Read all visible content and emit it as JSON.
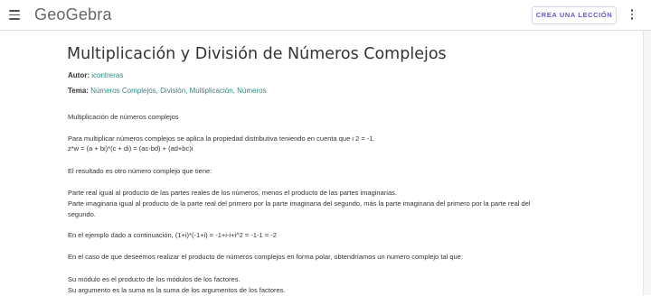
{
  "header": {
    "logo": "GeoGebra",
    "cta_label": "CREA UNA LECCIÓN"
  },
  "article": {
    "title": "Multiplicación y División de Números Complejos",
    "author_label": "Autor:",
    "author": "icontreras",
    "topic_label": "Tema:",
    "topics": [
      "Números Complejos",
      "División",
      "Multiplicación",
      "Números"
    ],
    "paragraphs": [
      "Multiplicación de números complejos",
      "Para multiplicar números complejos se aplica la propiedad distributiva teniendo en cuenta que i 2 = -1.",
      "z*w = (a + bi)*(c + di) = (ac-bd) + (ad+bc)i",
      "El resultado es otro número complejo que tiene:",
      "Parte real igual al producto de las partes reales de los números, menos el producto de las partes imaginarias.",
      "Parte imaginaria igual al producto de la parte real del primero por la parte imaginaria del segundo, más la parte imaginaria del primero por la parte real del",
      "segundo.",
      "En el ejemplo dado a continuación, (1+i)*(-1+i) = -1+i-i+i^2 = -1-1 = -2",
      "En el caso de que deseemos realizar el producto de números complejos en forma polar,  obtendríamos un numero complejo tal que:",
      "Su módulo es el producto de los módulos de los factores.",
      "Su argumento es la suma es la suma de los argumentos de los factores."
    ]
  },
  "colors": {
    "accent": "#6557d2",
    "link": "#2f8a82"
  }
}
